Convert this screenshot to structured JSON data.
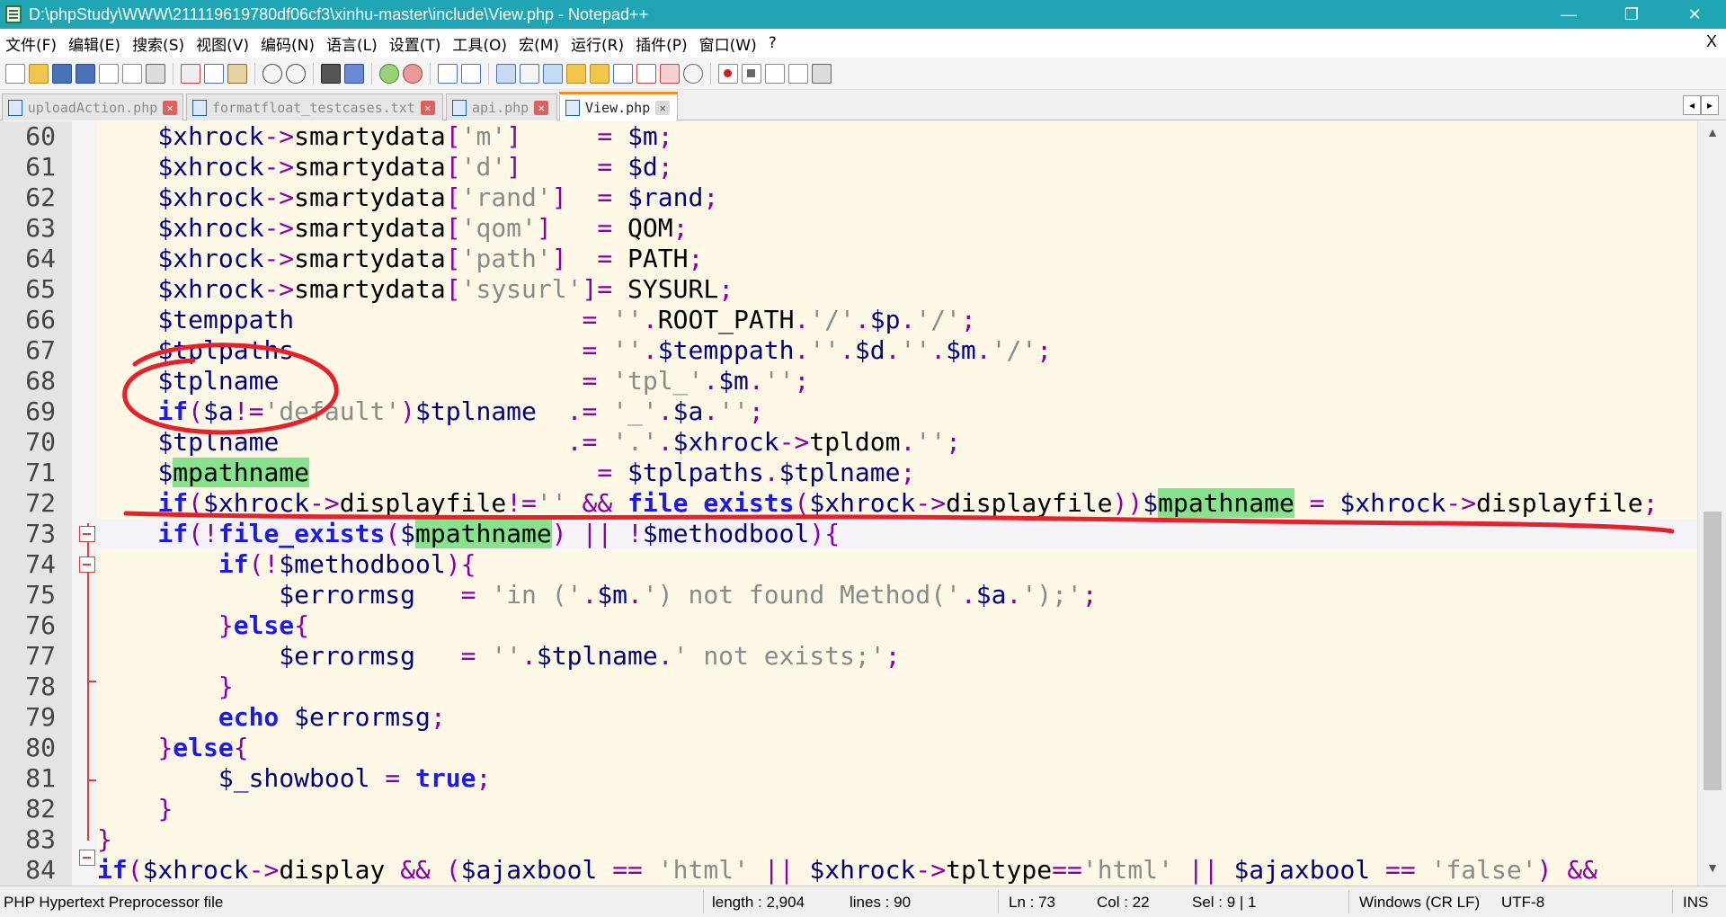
{
  "window": {
    "title": "D:\\phpStudy\\WWW\\211119619780df06cf3\\xinhu-master\\include\\View.php - Notepad++",
    "minimize": "—",
    "maximize": "❐",
    "close": "✕"
  },
  "menu": {
    "items": [
      "文件(F)",
      "编辑(E)",
      "搜索(S)",
      "视图(V)",
      "编码(N)",
      "语言(L)",
      "设置(T)",
      "工具(O)",
      "宏(M)",
      "运行(R)",
      "插件(P)",
      "窗口(W)",
      "?"
    ],
    "close": "X"
  },
  "tabs": [
    {
      "label": "uploadAction.php",
      "active": false
    },
    {
      "label": "formatfloat_testcases.txt",
      "active": false
    },
    {
      "label": "api.php",
      "active": false
    },
    {
      "label": "View.php",
      "active": true
    }
  ],
  "editor": {
    "line_numbers": [
      "60",
      "61",
      "62",
      "63",
      "64",
      "65",
      "66",
      "67",
      "68",
      "69",
      "70",
      "71",
      "72",
      "73",
      "74",
      "75",
      "76",
      "77",
      "78",
      "79",
      "80",
      "81",
      "82",
      "83",
      "84"
    ],
    "highlight_color": "#86e38b",
    "annotation_color": "#e8202a",
    "current_line": "73"
  },
  "status": {
    "filetype": "PHP Hypertext Preprocessor file",
    "length": "length : 2,904",
    "lines": "lines : 90",
    "ln": "Ln : 73",
    "col": "Col : 22",
    "sel": "Sel : 9 | 1",
    "eol": "Windows (CR LF)",
    "encoding": "UTF-8",
    "mode": "INS"
  }
}
